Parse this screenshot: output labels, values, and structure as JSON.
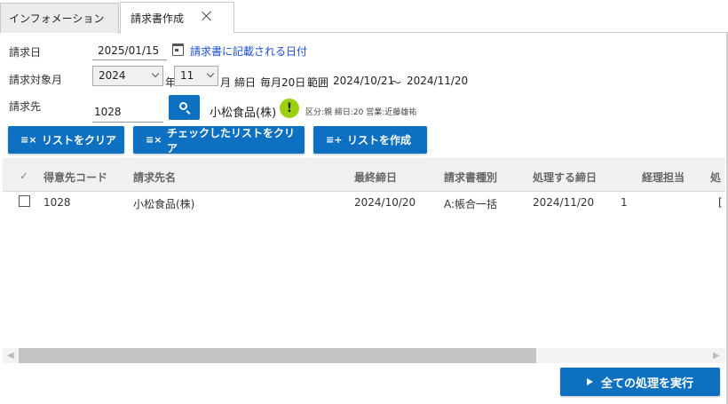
{
  "tabs": [
    {
      "label": "インフォメーション"
    },
    {
      "label": "請求書作成"
    }
  ],
  "form": {
    "invoice_date_label": "請求日",
    "invoice_date_value": "2025/01/15",
    "invoice_date_link": "請求書に記載される日付",
    "target_month_label": "請求対象月",
    "year_value": "2024",
    "year_unit": "年",
    "month_value": "11",
    "month_unit": "月",
    "closing_label": "締日",
    "closing_value": "毎月20日",
    "range_label": "範囲",
    "range_start": "2024/10/21",
    "range_sep": "〜",
    "range_end": "2024/11/20",
    "customer_label": "請求先",
    "customer_code": "1028",
    "customer_name": "小松食品(株)",
    "warning_mark": "!",
    "customer_meta": "区分:親 締日:20 営業:近藤雄祐"
  },
  "actions": {
    "clear_list": "リストをクリア",
    "clear_checked": "チェックしたリストをクリア",
    "create_list": "リストを作成",
    "execute_all": "全ての処理を実行"
  },
  "grid": {
    "check_header": "✓",
    "columns": [
      "得意先コード",
      "請求先名",
      "最終締日",
      "請求書種別",
      "処理する締日",
      "経理担当",
      "処"
    ],
    "rows": [
      {
        "code": "1028",
        "name": "小松食品(株)",
        "last_close": "2024/10/20",
        "type": "A:帳合一括",
        "process_close": "2024/11/20",
        "extra": "1",
        "tail": "["
      }
    ],
    "scroll_left": "◀",
    "scroll_right": "▶"
  },
  "colors": {
    "accent": "#0e70c0",
    "link": "#1a4fd6",
    "warning": "#9ad010"
  }
}
